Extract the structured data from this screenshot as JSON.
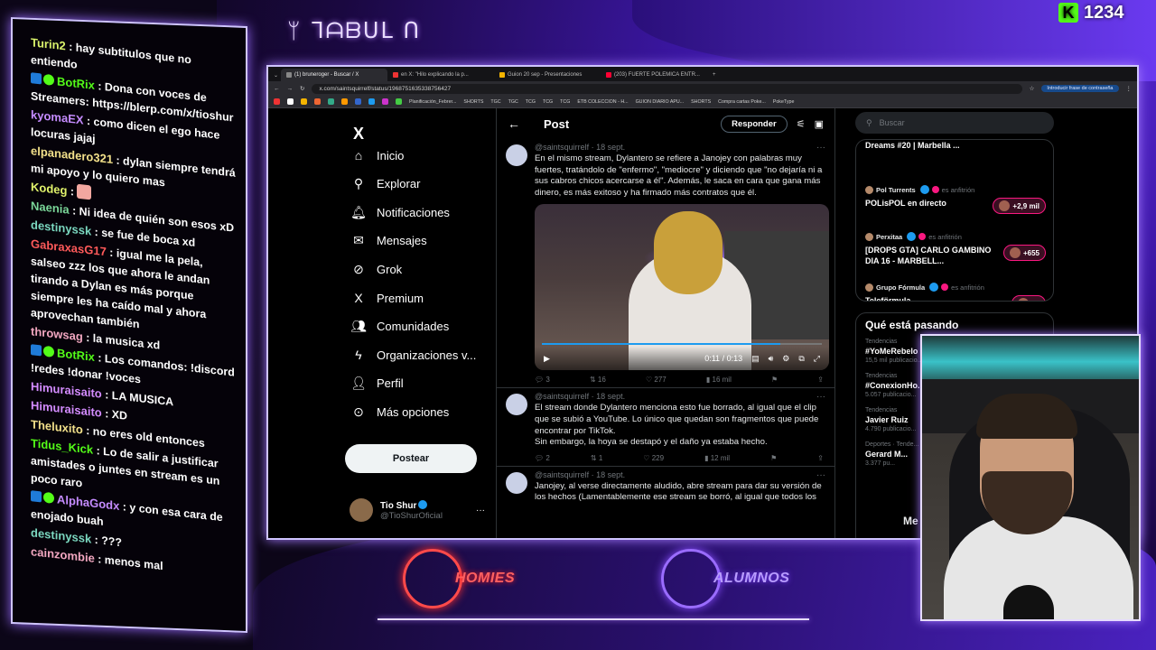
{
  "overlay": {
    "top_logo": "ᛘ ᒣᗩᗷᑌᒪ ᑎ",
    "kick_count": "1234",
    "bottom_logo_left": "HOMIES",
    "bottom_logo_right": "ALUMNOS"
  },
  "chat": {
    "messages": [
      {
        "user": "Turin2",
        "color": "#d9f26b",
        "text": " : hay subtitulos que no entiendo"
      },
      {
        "user": "BotRix",
        "color": "#53fc18",
        "text": " : Dona con voces de Streamers: https://blerp.com/x/tioshur",
        "badges": true
      },
      {
        "user": "kyomaEX",
        "color": "#c58cff",
        "text": " : como dicen el ego hace locuras jajaj"
      },
      {
        "user": "elpanadero321",
        "color": "#f2e08a",
        "text": " : dylan siempre tendrá mi apoyo y lo quiero mas"
      },
      {
        "user": "Kodeg",
        "color": "#e0f26b",
        "text": " : ",
        "emote": true
      },
      {
        "user": "Naenia",
        "color": "#7bd89a",
        "text": " : Ni idea de quién son esos xD"
      },
      {
        "user": "destinyssk",
        "color": "#7bd8c0",
        "text": " : se fue de boca xd"
      },
      {
        "user": "GabraxasG17",
        "color": "#ff5a5a",
        "text": " : igual me la pela, salseo zzz los que ahora le andan tirando a Dylan es más porque siempre les ha caído mal y ahora aprovechan también"
      },
      {
        "user": "throwsag",
        "color": "#f2a7c0",
        "text": " : la musica xd"
      },
      {
        "user": "BotRix",
        "color": "#53fc18",
        "text": " : Los comandos: !discord !redes !donar !voces",
        "badges": true
      },
      {
        "user": "Himuraisaito",
        "color": "#d48cff",
        "text": " : LA MUSICA"
      },
      {
        "user": "Himuraisaito",
        "color": "#d48cff",
        "text": " : XD"
      },
      {
        "user": "Theluxito",
        "color": "#f2e08a",
        "text": " : no eres old entonces"
      },
      {
        "user": "Tidus_Kick",
        "color": "#53fc18",
        "text": " : Lo de salir a justificar amistades o juntes en stream es un poco raro"
      },
      {
        "user": "AlphaGodx",
        "color": "#c58cff",
        "text": " : y con esa cara de enojado buah",
        "badges": true
      },
      {
        "user": "destinyssk",
        "color": "#7bd8c0",
        "text": " : ???"
      },
      {
        "user": "cainzombie",
        "color": "#f2a7c0",
        "text": " : menos mal"
      }
    ]
  },
  "browser": {
    "tabs": [
      "(1) bruneroger - Buscar / X",
      "en X: \"Hilo explicando la p...",
      "Guion 20 sep - Presentaciones",
      "(203) FUERTE POLEMICA ENTR..."
    ],
    "url": "x.com/saintsquirrelf/status/1968751635338756427",
    "password_button": "Introducir frase de contraseña",
    "bookmarks": [
      "Planificación_Febrer...",
      "SHORTS",
      "TGC",
      "TGC",
      "TCG",
      "TCG",
      "TCG",
      "ETB COLECCION - H...",
      "GUION DIARIO APU...",
      "SHORTS",
      "Compra cartas Poke...",
      "PokeType"
    ]
  },
  "xnav": {
    "logo": "X",
    "items": [
      "Inicio",
      "Explorar",
      "Notificaciones",
      "Mensajes",
      "Grok",
      "Premium",
      "Comunidades",
      "Organizaciones v...",
      "Perfil",
      "Más opciones"
    ],
    "post_button": "Postear",
    "profile_name": "Tio Shur",
    "profile_handle": "@TioShurOficial"
  },
  "timeline": {
    "title": "Post",
    "reply_button": "Responder",
    "tweets": [
      {
        "meta": "@saintsquirrelf · 18 sept.",
        "body": "En el mismo stream, Dylantero se refiere a Janojey con palabras muy fuertes, tratándolo de \"enfermo\", \"mediocre\" y diciendo que \"no dejaría ni a sus cabros chicos acercarse a él\". Además, le saca en cara que gana más dinero, es más exitoso y ha firmado más contratos que él.",
        "video_time": "0:11 / 0:13",
        "video_progress": 0.85,
        "replies": "3",
        "reposts": "16",
        "likes": "277",
        "views": "16 mil"
      },
      {
        "meta": "@saintsquirrelf · 18 sept.",
        "body": "El stream donde Dylantero menciona esto fue borrado, al igual que el clip que se subió a YouTube. Lo único que quedan son fragmentos que puede encontrar por TikTok.\nSin embargo, la hoya se destapó y el daño ya estaba hecho.",
        "replies": "2",
        "reposts": "1",
        "likes": "229",
        "views": "12 mil"
      },
      {
        "meta": "@saintsquirrelf · 18 sept.",
        "body": "Janojey, al verse directamente aludido, abre stream para dar su versión de los hechos (Lamentablemente ese stream se borró, al igual que todos los"
      }
    ]
  },
  "rightcol": {
    "search_placeholder": "Buscar",
    "spaces": [
      {
        "host": "",
        "title": "Dreams #20 | Marbella ...",
        "pill": ""
      },
      {
        "host": "Pol Turrents",
        "tag": "es anfitrión",
        "title": "POLisPOL en directo",
        "pill": "+2,9 mil"
      },
      {
        "host": "Perxitaa",
        "tag": "es anfitrión",
        "title": "[DROPS GTA] CARLO GAMBINO DIA 16 - MARBELL...",
        "pill": "+655"
      },
      {
        "host": "Grupo Fórmula",
        "tag": "es anfitrión",
        "title": "Teleförmula",
        "pill": "+4"
      }
    ],
    "trends_title": "Qué está pasando",
    "trends": [
      {
        "cat": "Tendencias",
        "name": "#YoMeRebelo",
        "posts": "15,5 mil publicacio..."
      },
      {
        "cat": "Tendencias",
        "name": "#ConexionHo...",
        "posts": "5.057 publicacio..."
      },
      {
        "cat": "Tendencias",
        "name": "Javier Ruiz",
        "posts": "4.790 publicacio..."
      },
      {
        "cat": "Deportes · Tende...",
        "name": "Gerard M...",
        "posts": "3.377 pu..."
      }
    ],
    "partial_label": "Me"
  }
}
